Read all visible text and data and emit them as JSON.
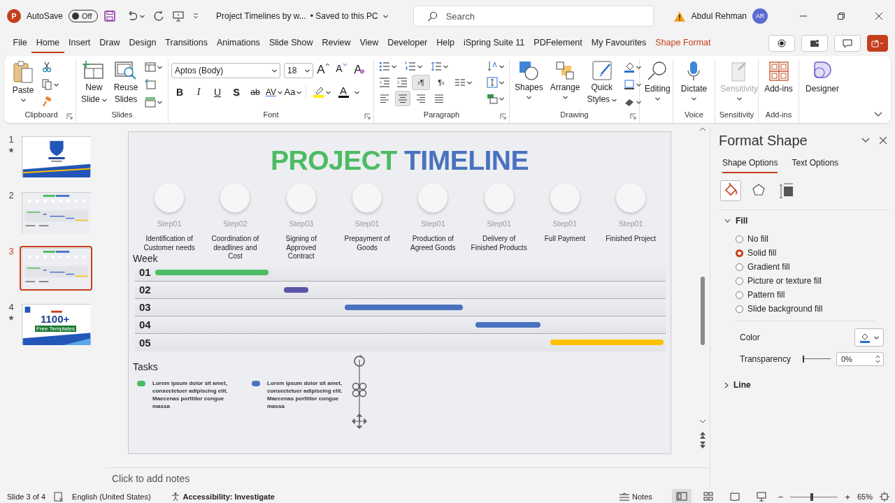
{
  "title_bar": {
    "app_logo": "P",
    "autosave": {
      "label": "AutoSave",
      "on": false,
      "state_text": "Off"
    },
    "document_title": "Project Timelines by w...",
    "save_status": "• Saved to this PC",
    "search": {
      "placeholder": "Search"
    },
    "user": {
      "name": "Abdul Rehman",
      "initials": "AR"
    }
  },
  "menu_tabs": [
    {
      "label": "File",
      "selected": false,
      "kind": "normal"
    },
    {
      "label": "Home",
      "selected": true,
      "kind": "normal"
    },
    {
      "label": "Insert",
      "selected": false,
      "kind": "normal"
    },
    {
      "label": "Draw",
      "selected": false,
      "kind": "normal"
    },
    {
      "label": "Design",
      "selected": false,
      "kind": "normal"
    },
    {
      "label": "Transitions",
      "selected": false,
      "kind": "normal"
    },
    {
      "label": "Animations",
      "selected": false,
      "kind": "normal"
    },
    {
      "label": "Slide Show",
      "selected": false,
      "kind": "normal"
    },
    {
      "label": "Review",
      "selected": false,
      "kind": "normal"
    },
    {
      "label": "View",
      "selected": false,
      "kind": "normal"
    },
    {
      "label": "Developer",
      "selected": false,
      "kind": "normal"
    },
    {
      "label": "Help",
      "selected": false,
      "kind": "normal"
    },
    {
      "label": "iSpring Suite 11",
      "selected": false,
      "kind": "normal"
    },
    {
      "label": "PDFelement",
      "selected": false,
      "kind": "normal"
    },
    {
      "label": "My Favourites",
      "selected": false,
      "kind": "normal"
    },
    {
      "label": "Shape Format",
      "selected": false,
      "kind": "contextual"
    }
  ],
  "ribbon": {
    "clipboard": {
      "paste": "Paste",
      "label": "Clipboard"
    },
    "slides": {
      "new_slide": "New Slide",
      "reuse_slides": "Reuse Slides",
      "label": "Slides"
    },
    "font": {
      "font_name": "Aptos (Body)",
      "font_size": "18",
      "grow": "A",
      "shrink": "A",
      "clear": "A",
      "font_color": "A",
      "label": "Font",
      "format_buttons": [
        {
          "text": "B",
          "kind": "bold"
        },
        {
          "text": "I",
          "kind": "italic"
        },
        {
          "text": "U",
          "kind": "underline"
        },
        {
          "text": "S",
          "kind": "shadow"
        },
        {
          "text": "ab",
          "kind": "strike"
        },
        {
          "text": "AV",
          "kind": "spacing"
        },
        {
          "text": "Aa",
          "kind": "case"
        }
      ]
    },
    "paragraph": {
      "label": "Paragraph",
      "direction_buttons": [
        {
          "text": "›¶",
          "selected": true
        },
        {
          "text": "¶‹",
          "selected": false
        }
      ],
      "align_buttons": [
        {
          "kind": "left",
          "selected": false
        },
        {
          "kind": "center",
          "selected": true
        },
        {
          "kind": "right",
          "selected": false
        },
        {
          "kind": "justify",
          "selected": false
        }
      ]
    },
    "drawing": {
      "shapes": "Shapes",
      "arrange": "Arrange",
      "quick_styles": "Quick Styles",
      "label": "Drawing"
    },
    "editing": {
      "button": "Editing"
    },
    "voice": {
      "dictate": "Dictate",
      "label": "Voice"
    },
    "sensitivity": {
      "button": "Sensitivity",
      "disabled": true,
      "label": "Sensitivity"
    },
    "add_ins": {
      "button": "Add-ins",
      "label": "Add-ins"
    },
    "designer": {
      "button": "Designer"
    }
  },
  "thumbnails": [
    {
      "number": "1",
      "animated": true,
      "selected": false,
      "kind": "title"
    },
    {
      "number": "2",
      "animated": false,
      "selected": false,
      "kind": "timeline"
    },
    {
      "number": "3",
      "animated": false,
      "selected": true,
      "kind": "timeline"
    },
    {
      "number": "4",
      "animated": true,
      "selected": false,
      "kind": "promo",
      "headline": "1100+",
      "caption": "Free Templates"
    }
  ],
  "slide": {
    "title_first": "PROJECT",
    "title_second": "TIMELINE",
    "steps": [
      {
        "step": "Step01",
        "description": "Identification of Customer needs"
      },
      {
        "step": "Step02",
        "description": "Coordination of deadlines and Cost"
      },
      {
        "step": "Step03",
        "description": "Signing of Approved Contract"
      },
      {
        "step": "Step01",
        "description": "Prepayment of Goods"
      },
      {
        "step": "Step01",
        "description": "Production of Agreed Goods"
      },
      {
        "step": "Step01",
        "description": "Delivery of Finished Products"
      },
      {
        "step": "Step01",
        "description": "Full Payment"
      },
      {
        "step": "Step01",
        "description": "Finished Project"
      }
    ],
    "week_label": "Week",
    "weeks": [
      {
        "label": "01",
        "color": "#4dbb63"
      },
      {
        "label": "02",
        "color": "#5b55a8"
      },
      {
        "label": "03",
        "color": "#4a72c0"
      },
      {
        "label": "04",
        "color": "#4a72c0"
      },
      {
        "label": "05",
        "color": "#ffc000"
      }
    ],
    "tasks_label": "Tasks",
    "tasks": [
      {
        "color": "#4dbb63",
        "text": "Lorem ipsum dolor sit amet, consectetuer adipiscing elit. Maecenas porttitor congue massa"
      },
      {
        "color": "#4a72c0",
        "text": "Lorem ipsum dolor sit amet, consectetuer adipiscing elit. Maecenas porttitor congue massa"
      }
    ]
  },
  "notes": {
    "placeholder": "Click to add notes"
  },
  "format_pane": {
    "title": "Format Shape",
    "tabs": [
      {
        "label": "Shape Options",
        "selected": true
      },
      {
        "label": "Text Options",
        "selected": false
      }
    ],
    "icon_tabs": [
      {
        "kind": "fill",
        "selected": true
      },
      {
        "kind": "effects",
        "selected": false
      },
      {
        "kind": "size",
        "selected": false
      }
    ],
    "fill": {
      "label": "Fill",
      "expanded": true,
      "options": [
        {
          "label": "No fill",
          "selected": false
        },
        {
          "label": "Solid fill",
          "selected": true
        },
        {
          "label": "Gradient fill",
          "selected": false
        },
        {
          "label": "Picture or texture fill",
          "selected": false
        },
        {
          "label": "Pattern fill",
          "selected": false
        },
        {
          "label": "Slide background fill",
          "selected": false
        }
      ],
      "color_label": "Color",
      "transparency_label": "Transparency",
      "transparency": {
        "level": 0,
        "value": "0%"
      }
    },
    "line": {
      "label": "Line",
      "expanded": false
    }
  },
  "status_bar": {
    "slide_info": "Slide 3 of 4",
    "language": "English (United States)",
    "accessibility": "Accessibility: Investigate",
    "notes_button": "Notes",
    "view_buttons": [
      {
        "kind": "normal",
        "selected": true
      },
      {
        "kind": "sorter",
        "selected": false
      },
      {
        "kind": "reading",
        "selected": false
      },
      {
        "kind": "slideshow",
        "selected": false
      }
    ],
    "zoom": {
      "out": "−",
      "in": "+",
      "level": 0.45,
      "value": "65%"
    }
  }
}
